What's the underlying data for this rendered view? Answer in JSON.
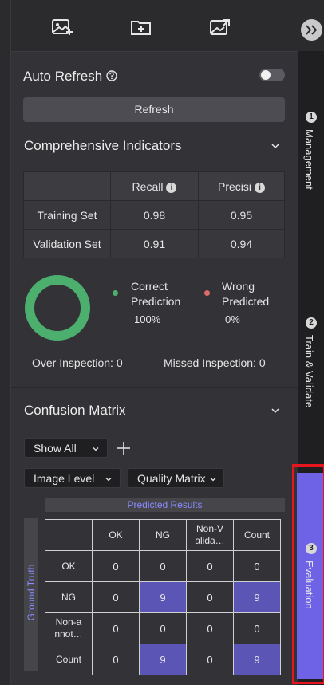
{
  "toolbar": {
    "icons": [
      "add-image-icon",
      "add-folder-icon",
      "export-image-icon"
    ]
  },
  "auto_refresh": {
    "label": "Auto Refresh",
    "enabled": false
  },
  "refresh_button": {
    "label": "Refresh"
  },
  "indicators": {
    "title": "Comprehensive Indicators",
    "columns": [
      "Recall",
      "Precisi"
    ],
    "rows": [
      {
        "label": "Training Set",
        "recall": "0.98",
        "precision": "0.95"
      },
      {
        "label": "Validation Set",
        "recall": "0.91",
        "precision": "0.94"
      }
    ],
    "correct_label_1": "Correct",
    "correct_label_2": "Prediction",
    "correct_value": "100%",
    "wrong_label_1": "Wrong",
    "wrong_label_2": "Predicted",
    "wrong_value": "0%",
    "correct_fraction": 1.0,
    "over_inspection": "Over Inspection:  0",
    "missed_inspection": "Missed Inspection:  0",
    "colors": {
      "correct": "#4caf6e",
      "wrong": "#e06b6b"
    }
  },
  "confusion_matrix": {
    "title": "Confusion Matrix",
    "filter_select": "Show All",
    "level_select": "Image Level",
    "matrix_select": "Quality Matrix",
    "predicted_header": "Predicted Results",
    "ground_truth_header": "Ground Truth",
    "columns": [
      "OK",
      "NG",
      "Non-V alida…",
      "Count"
    ],
    "rows": [
      {
        "label": "OK",
        "values": [
          "0",
          "0",
          "0",
          "0"
        ]
      },
      {
        "label": "NG",
        "values": [
          "0",
          "9",
          "0",
          "9"
        ]
      },
      {
        "label": "Non-a nnot…",
        "values": [
          "0",
          "0",
          "0",
          "0"
        ]
      },
      {
        "label": "Count",
        "values": [
          "0",
          "9",
          "0",
          "9"
        ]
      }
    ],
    "highlight_color": "#5b56b5"
  },
  "side_tabs": [
    {
      "number": "1",
      "label": "Management"
    },
    {
      "number": "2",
      "label": "Train & Validate"
    },
    {
      "number": "3",
      "label": "Evaluation",
      "active": true
    }
  ],
  "accent": "#6e63e6"
}
